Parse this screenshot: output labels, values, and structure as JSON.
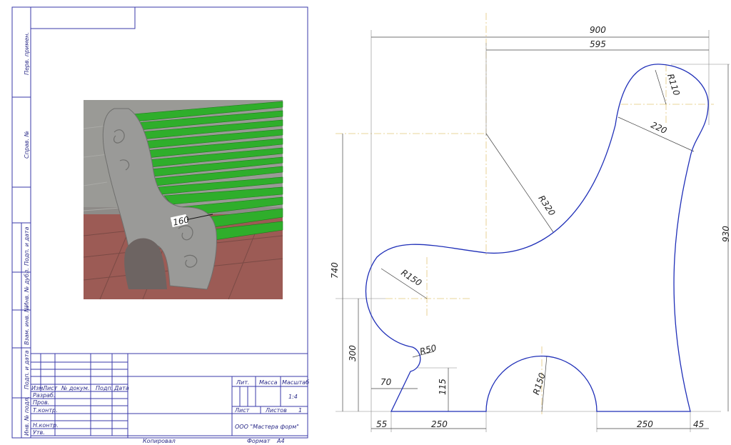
{
  "sidebar_labels": [
    "Перв. примен.",
    "Справ. №",
    "Подп. и дата",
    "Инв. № дубл.",
    "Взам. инв. №",
    "Подп. и дата",
    "Инв. № подл."
  ],
  "photo": {
    "description_colors": {
      "seat": "#2fae2b",
      "stone": "#9a9a98",
      "paving": "#9c5b55"
    },
    "dimension": "160"
  },
  "title_block": {
    "headers": [
      "Изм.",
      "Лист",
      "№ докум.",
      "Подп.",
      "Дата"
    ],
    "roles": [
      "Разраб.",
      "Пров.",
      "Т.контр.",
      "Н.контр.",
      "Утв."
    ],
    "lit": "Лит.",
    "mass": "Масса",
    "scale": "Масштаб",
    "scale_value": "1:4",
    "sheet": "Лист",
    "sheets": "Листов",
    "sheets_value": "1",
    "company": "ООО \"Мастера форм\"",
    "copied": "Копировал",
    "format_label": "Формат",
    "format_value": "A4"
  },
  "dimensions": {
    "d900": "900",
    "d595": "595",
    "r110": "R110",
    "d220": "220",
    "r320": "R320",
    "d930": "930",
    "d740": "740",
    "r150_left": "R150",
    "d300": "300",
    "r50": "R50",
    "d70": "70",
    "d115": "115",
    "r150_bottom": "R150",
    "d55": "55",
    "d250_left": "250",
    "d250_right": "250",
    "d45": "45"
  },
  "colors": {
    "frame": "#3a3aaa",
    "profile": "#1f2fb8",
    "centerline": "#e3c77a"
  }
}
